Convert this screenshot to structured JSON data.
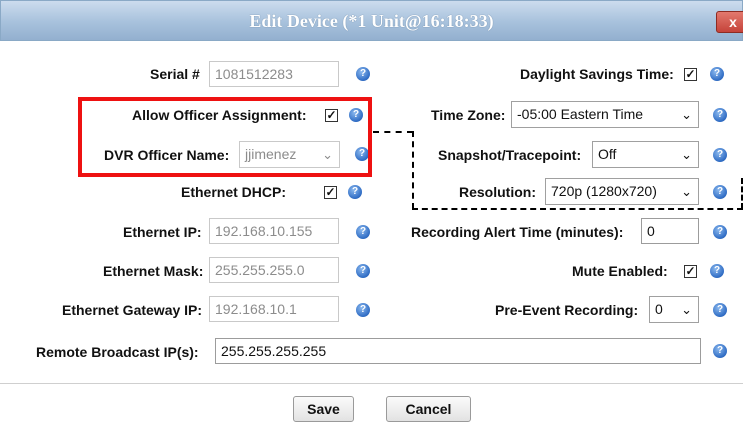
{
  "dialog": {
    "title": "Edit Device (*1 Unit@16:18:33)",
    "close_label": "x"
  },
  "left": {
    "serial": {
      "label": "Serial #",
      "value": "1081512283"
    },
    "allow_officer": {
      "label": "Allow Officer Assignment:",
      "checked": true
    },
    "dvr_officer": {
      "label": "DVR Officer Name:",
      "value": "jjimenez"
    },
    "dhcp": {
      "label": "Ethernet DHCP:",
      "checked": true
    },
    "ip": {
      "label": "Ethernet IP:",
      "value": "192.168.10.155"
    },
    "mask": {
      "label": "Ethernet Mask:",
      "value": "255.255.255.0"
    },
    "gateway": {
      "label": "Ethernet Gateway IP:",
      "value": "192.168.10.1"
    }
  },
  "right": {
    "dst": {
      "label": "Daylight Savings Time:",
      "checked": true
    },
    "timezone": {
      "label": "Time Zone:",
      "value": "-05:00 Eastern Time"
    },
    "snapshot": {
      "label": "Snapshot/Tracepoint:",
      "value": "Off"
    },
    "resolution": {
      "label": "Resolution:",
      "value": "720p (1280x720)"
    },
    "alert_time": {
      "label": "Recording Alert Time (minutes):",
      "value": "0"
    },
    "mute": {
      "label": "Mute Enabled:",
      "checked": true
    },
    "pre_event": {
      "label": "Pre-Event Recording:",
      "value": "0"
    }
  },
  "broadcast": {
    "label": "Remote Broadcast IP(s):",
    "value": "255.255.255.255"
  },
  "buttons": {
    "save": "Save",
    "cancel": "Cancel"
  },
  "glyphs": {
    "check": "✓",
    "chevron": "⌄",
    "help": "?"
  },
  "colors": {
    "highlight": "#ee1111",
    "title_bar": "#a7c1dc",
    "help_icon": "#2f6cc4"
  }
}
